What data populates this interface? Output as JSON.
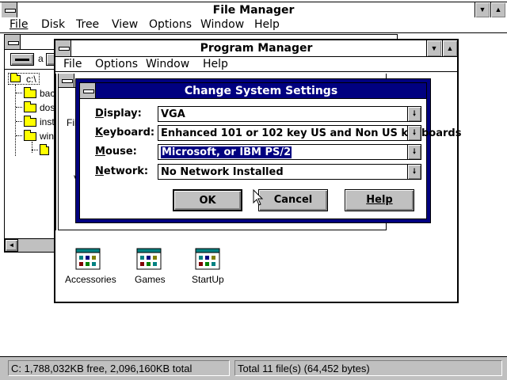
{
  "file_manager": {
    "title": "File Manager",
    "menu": [
      "File",
      "Disk",
      "Tree",
      "View",
      "Options",
      "Window",
      "Help"
    ],
    "drive_label": "a",
    "tree_root": "c:\\",
    "tree_items": [
      "back",
      "dos",
      "insta",
      "wind"
    ],
    "status_free": "C: 1,788,032KB free,  2,096,160KB total",
    "status_total": "Total 11 file(s) (64,452 bytes)"
  },
  "program_manager": {
    "title": "Program Manager",
    "menu": [
      "File",
      "Options",
      "Window",
      "Help"
    ],
    "groups": [
      {
        "label": "Accessories"
      },
      {
        "label": "Games"
      },
      {
        "label": "StartUp"
      }
    ]
  },
  "behind_window": {
    "partial_menu": "Fil",
    "partial_text": "V"
  },
  "dialog": {
    "title": "Change System Settings",
    "rows": [
      {
        "label": "Display:",
        "value": "VGA"
      },
      {
        "label": "Keyboard:",
        "value": "Enhanced 101 or 102 key US and Non US keyboards"
      },
      {
        "label": "Mouse:",
        "value": "Microsoft, or IBM PS/2"
      },
      {
        "label": "Network:",
        "value": "No Network Installed"
      }
    ],
    "ok_label": "OK",
    "cancel_label": "Cancel",
    "help_label": "Help"
  },
  "colors": {
    "active_title": "#000080",
    "face": "#c0c0c0"
  }
}
